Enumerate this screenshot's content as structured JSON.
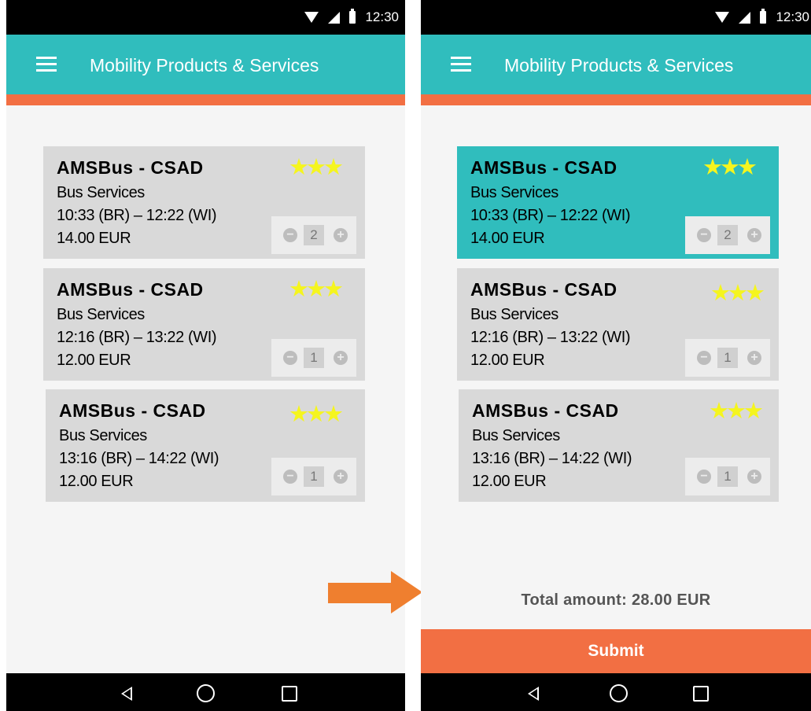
{
  "status_bar": {
    "time": "12:30",
    "icons": [
      "wifi-icon",
      "signal-icon",
      "battery-icon"
    ]
  },
  "app_bar": {
    "title": "Mobility Products & Services",
    "menu_icon": "menu-icon"
  },
  "left_screen": {
    "cards": [
      {
        "title": "AMSBus - CSAD",
        "category": "Bus Services",
        "time": "10:33 (BR) – 12:22 (WI)",
        "price": "14.00 EUR",
        "rating": "★★★",
        "quantity": "2",
        "selected": false
      },
      {
        "title": "AMSBus - CSAD",
        "category": "Bus Services",
        "time": "12:16 (BR) – 13:22 (WI)",
        "price": "12.00 EUR",
        "rating": "★★★",
        "quantity": "1",
        "selected": false
      },
      {
        "title": "AMSBus - CSAD",
        "category": "Bus Services",
        "time": "13:16 (BR) – 14:22 (WI)",
        "price": "12.00 EUR",
        "rating": "★★★",
        "quantity": "1",
        "selected": false
      }
    ]
  },
  "right_screen": {
    "cards": [
      {
        "title": "AMSBus - CSAD",
        "category": "Bus Services",
        "time": "10:33 (BR) – 12:22 (WI)",
        "price": "14.00 EUR",
        "rating": "★★★",
        "quantity": "2",
        "selected": true
      },
      {
        "title": "AMSBus - CSAD",
        "category": "Bus Services",
        "time": "12:16 (BR) – 13:22 (WI)",
        "price": "12.00 EUR",
        "rating": "★★★",
        "quantity": "1",
        "selected": false
      },
      {
        "title": "AMSBus - CSAD",
        "category": "Bus Services",
        "time": "13:16 (BR) – 14:22 (WI)",
        "price": "12.00 EUR",
        "rating": "★★★",
        "quantity": "1",
        "selected": false
      }
    ],
    "total": "Total amount: 28.00 EUR",
    "submit_label": "Submit"
  },
  "stepper": {
    "minus": "−",
    "plus": "+"
  },
  "nav_bar": {
    "icons": [
      "back-icon",
      "home-icon",
      "recents-icon"
    ]
  },
  "colors": {
    "teal": "#30bdbd",
    "orange": "#f26f43",
    "card": "#d9d9d9",
    "star": "#f5f51e",
    "arrow": "#ef7f2f"
  }
}
